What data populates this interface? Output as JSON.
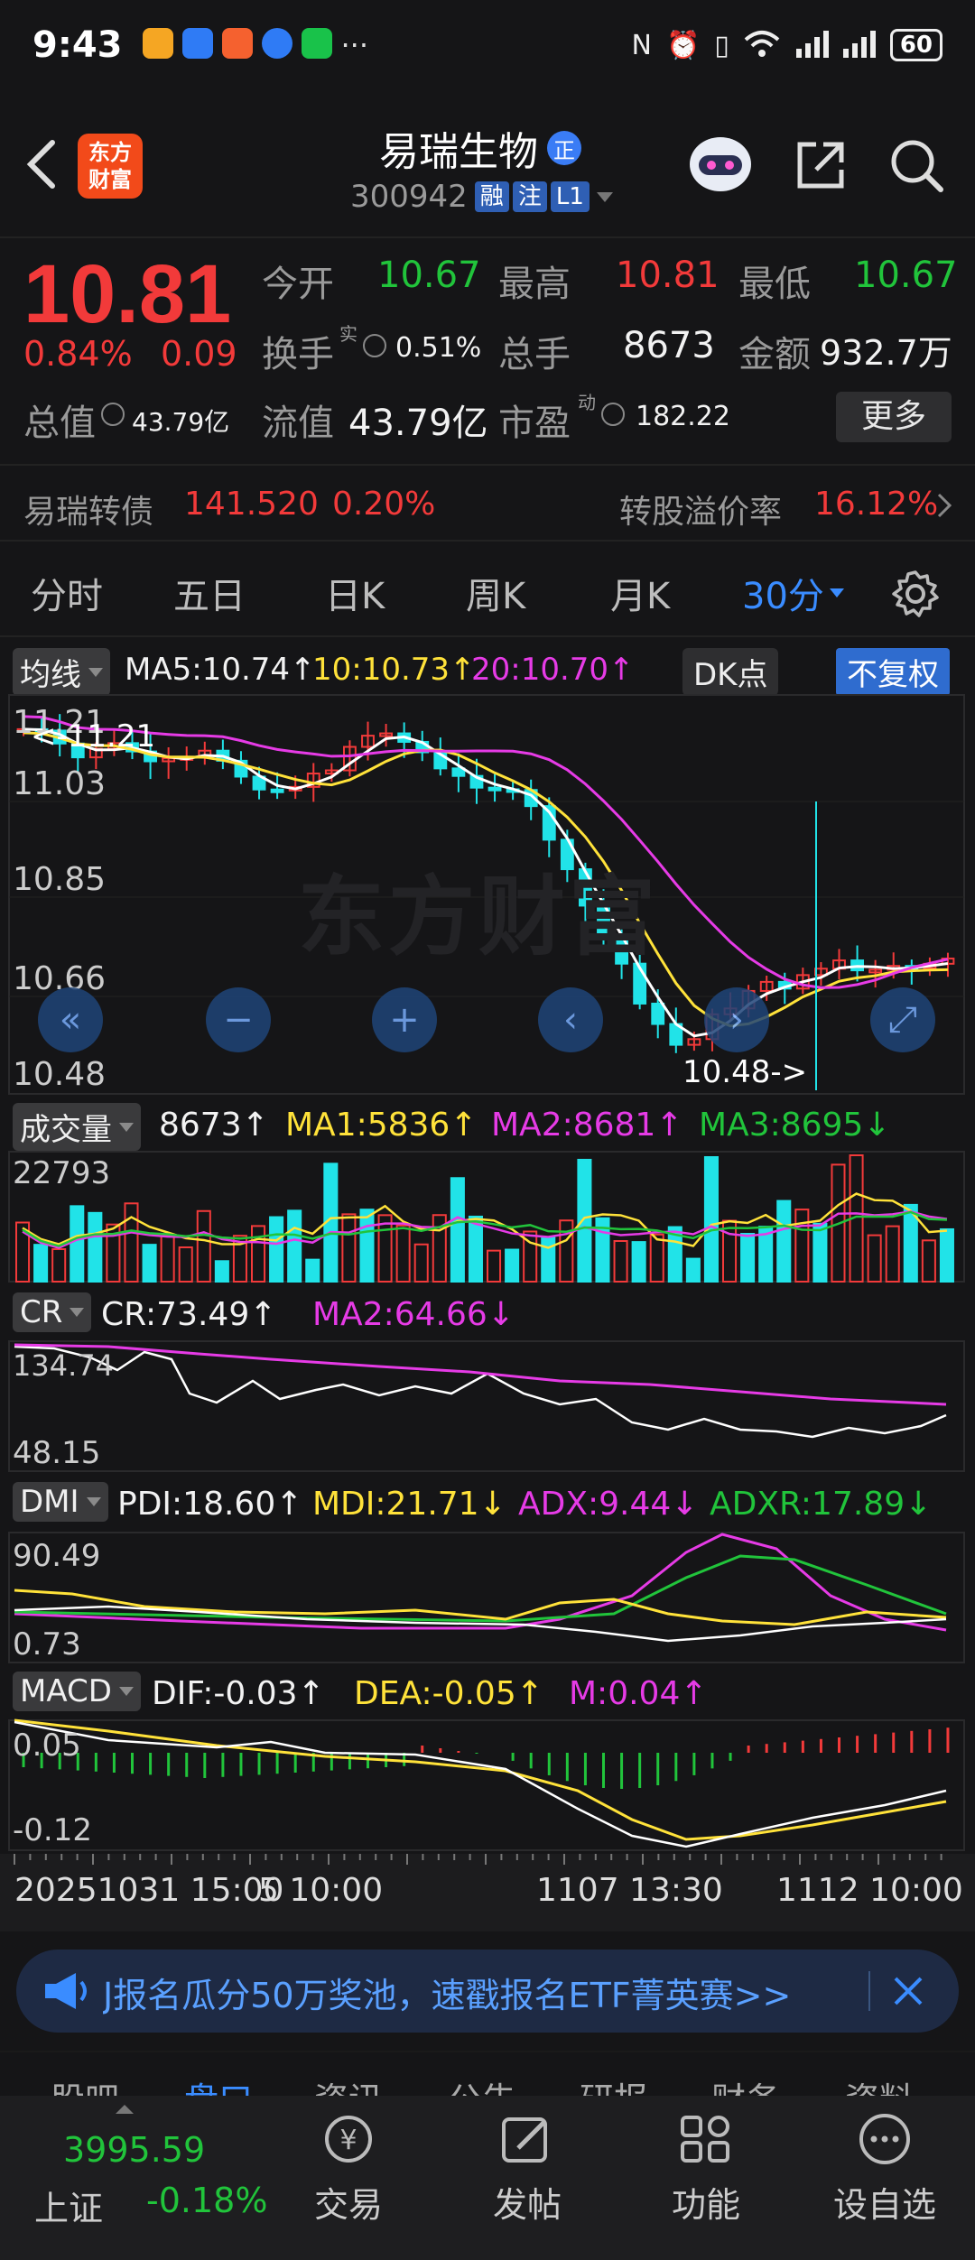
{
  "status_bar": {
    "time": "9:43",
    "more": "···",
    "battery": "60"
  },
  "header": {
    "logo_line1": "东方",
    "logo_line2": "财富",
    "stock_name": "易瑞生物",
    "name_badge": "正",
    "code": "300942",
    "badge_rong": "融",
    "badge_zhu": "注",
    "badge_level": "L1"
  },
  "quote": {
    "price": "10.81",
    "change_pct": "0.84%",
    "change_amt": "0.09",
    "open_label": "今开",
    "open": "10.67",
    "high_label": "最高",
    "high": "10.81",
    "low_label": "最低",
    "low": "10.67",
    "turnover_label": "换手",
    "turnover_sup": "实",
    "turnover": "0.51%",
    "volume_label": "总手",
    "volume": "8673",
    "amount_label": "金额",
    "amount": "932.7万",
    "mktcap_label": "总值",
    "mktcap": "43.79亿",
    "float_label": "流值",
    "float_cap": "43.79亿",
    "pe_label": "市盈",
    "pe_sup": "动",
    "pe": "182.22",
    "more_button": "更多"
  },
  "bond": {
    "name": "易瑞转债",
    "price": "141.520",
    "pct": "0.20%",
    "premium_label": "转股溢价率",
    "premium": "16.12%"
  },
  "period_tabs": [
    "分时",
    "五日",
    "日K",
    "周K",
    "月K",
    "30分"
  ],
  "active_tab": "30分",
  "ma_bar": {
    "label": "均线",
    "ma5": "MA5:10.74↑",
    "ma10": "10:10.73↑",
    "ma20": "20:10.70↑",
    "dk": "DK点",
    "fq": "不复权"
  },
  "kline": {
    "y_labels": [
      "11.21",
      "11.03",
      "10.85",
      "10.66",
      "10.48"
    ],
    "high_mark": "11.21",
    "low_mark": "10.48->",
    "watermark": "东方财富"
  },
  "volume_panel": {
    "label": "成交量",
    "value": "8673↑",
    "ma1": "MA1:5836↑",
    "ma2": "MA2:8681↑",
    "ma3": "MA3:8695↓",
    "y_max": "22793"
  },
  "cr_panel": {
    "label": "CR",
    "cr": "CR:73.49↑",
    "ma2": "MA2:64.66↓",
    "y_max": "134.74",
    "y_min": "48.15"
  },
  "dmi_panel": {
    "label": "DMI",
    "pdi": "PDI:18.60↑",
    "mdi": "MDI:21.71↓",
    "adx": "ADX:9.44↓",
    "adxr": "ADXR:17.89↓",
    "y_max": "90.49",
    "y_min": "0.73"
  },
  "macd_panel": {
    "label": "MACD",
    "dif": "DIF:-0.03↑",
    "dea": "DEA:-0.05↑",
    "m": "M:0.04↑",
    "y_max": "0.05",
    "y_min": "-0.12"
  },
  "x_axis": [
    "20251031 15:00",
    "5 10:00",
    "1107 13:30",
    "1112 10:00"
  ],
  "banner": {
    "text": "J报名瓜分50万奖池，速戳报名ETF菁英赛>>"
  },
  "sub_tabs_partial": [
    "股吧",
    "盘口",
    "资讯",
    "公告",
    "研报",
    "财务",
    "资料"
  ],
  "bottom_nav": {
    "index_value": "3995.59",
    "index_name": "上证",
    "index_pct": "-0.18%",
    "items": [
      "交易",
      "发帖",
      "功能",
      "设自选"
    ]
  },
  "colors": {
    "up": "#f23a3a",
    "down": "#21e3e8",
    "ma5": "#ffffff",
    "ma10": "#ffe23a",
    "ma20": "#e63be6",
    "accent": "#3a8cff"
  }
}
